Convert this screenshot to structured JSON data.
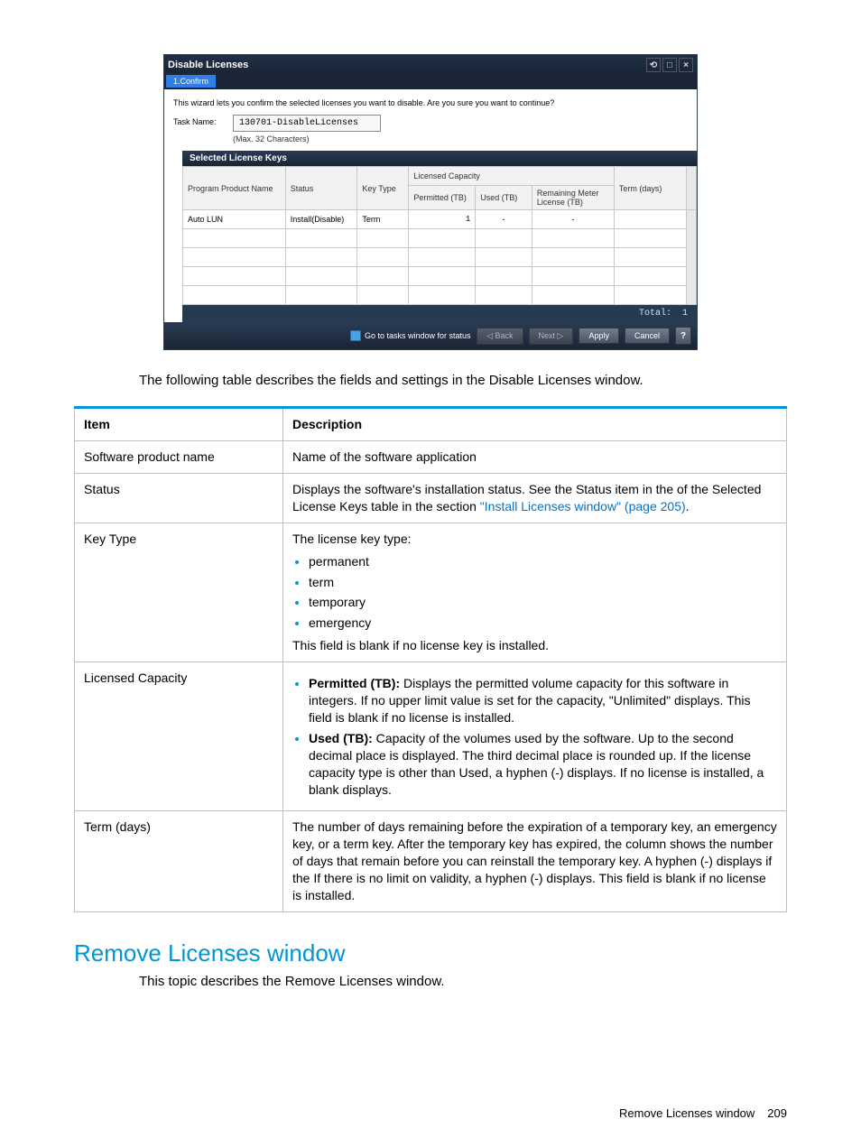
{
  "win": {
    "title": "Disable Licenses",
    "step": "1.Confirm",
    "hint": "This wizard lets you confirm the selected licenses you want to disable. Are you sure you want to continue?",
    "task_label": "Task Name:",
    "task_value": "130701-DisableLicenses",
    "task_help": "(Max. 32 Characters)",
    "section": "Selected License Keys",
    "headers": {
      "program": "Program Product Name",
      "status": "Status",
      "keytype": "Key Type",
      "cap_group": "Licensed Capacity",
      "permitted": "Permitted (TB)",
      "used": "Used (TB)",
      "remaining": "Remaining Meter License (TB)",
      "term": "Term (days)"
    },
    "row": {
      "program": "Auto LUN",
      "status": "Install(Disable)",
      "keytype": "Term",
      "permitted": "1",
      "used": "-",
      "remaining": "-",
      "term": ""
    },
    "total_label": "Total:",
    "total_value": "1",
    "chk_label": "Go to tasks window for status",
    "btn_back": "◁ Back",
    "btn_next": "Next ▷",
    "btn_apply": "Apply",
    "btn_cancel": "Cancel"
  },
  "para_intro": "The following table describes the fields and settings in the Disable Licenses window.",
  "desc": {
    "h_item": "Item",
    "h_desc": "Description",
    "r1_item": "Software product name",
    "r1_desc": "Name of the software application",
    "r2_item": "Status",
    "r2_desc_a": "Displays the software's installation status. See the Status item in the of the Selected License Keys table in the section ",
    "r2_link": "\"Install Licenses window\" (page 205)",
    "r2_desc_b": ".",
    "r3_item": "Key Type",
    "r3_lead": "The license key type:",
    "r3_li1": "permanent",
    "r3_li2": "term",
    "r3_li3": "temporary",
    "r3_li4": "emergency",
    "r3_tail": "This field is blank if no license key is installed.",
    "r4_item": "Licensed Capacity",
    "r4_li1_b": "Permitted (TB):",
    "r4_li1_t": " Displays the permitted volume capacity for this software in integers. If no upper limit value is set for the capacity, \"Unlimited\" displays. This field is blank if no license is installed.",
    "r4_li2_b": "Used (TB):",
    "r4_li2_t": " Capacity of the volumes used by the software. Up to the second decimal place is displayed. The third decimal place is rounded up. If the license capacity type is other than Used, a hyphen (-) displays. If no license is installed, a blank displays.",
    "r5_item": "Term (days)",
    "r5_desc": "The number of days remaining before the expiration of a temporary key, an emergency key, or a term key. After the temporary key has expired, the column shows the number of days that remain before you can reinstall the temporary key. A hyphen (-) displays if the If there is no limit on validity, a hyphen (-) displays. This field is blank if no license is installed."
  },
  "h2": "Remove Licenses window",
  "para2": "This topic describes the Remove Licenses window.",
  "footer_text": "Remove Licenses window",
  "footer_page": "209"
}
